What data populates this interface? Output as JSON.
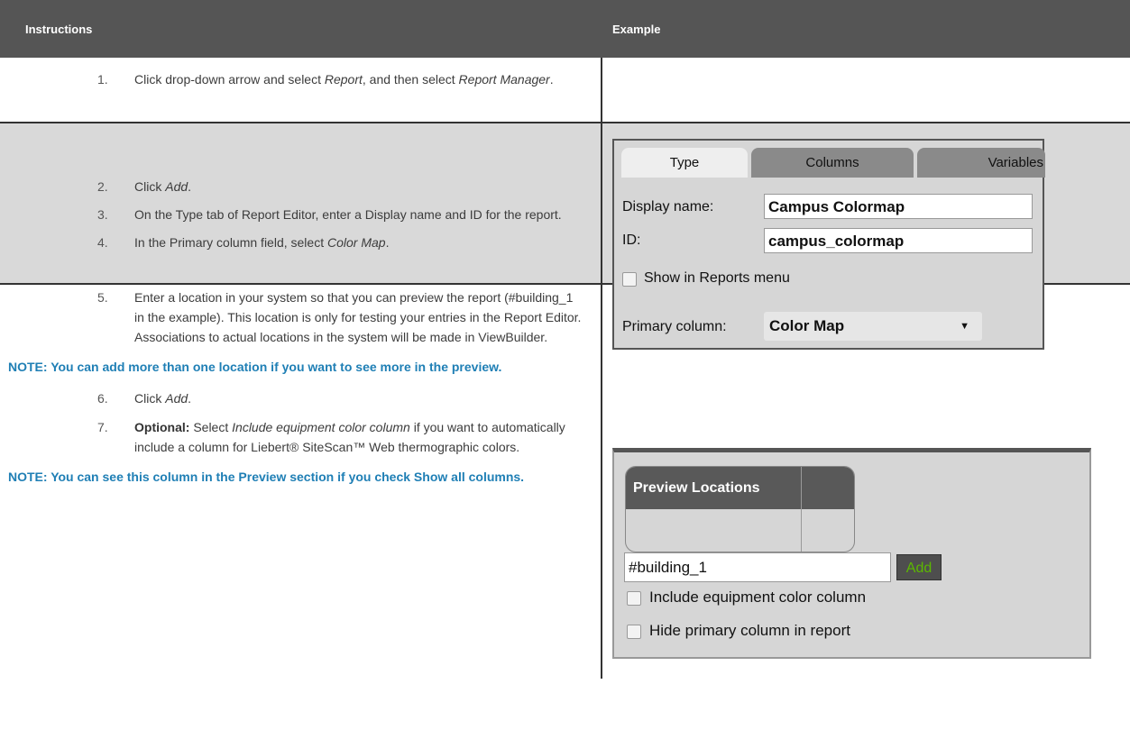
{
  "header": {
    "instructions": "Instructions",
    "example": "Example"
  },
  "steps": {
    "s1": {
      "num": "1.",
      "a": "Click drop-down arrow and select ",
      "b": "Report",
      "c": ", and then select ",
      "d": "Report Manager",
      "e": "."
    },
    "s2": {
      "num": "2.",
      "a": "Click ",
      "b": "Add",
      "c": "."
    },
    "s3": {
      "num": "3.",
      "text": "On the Type tab of Report Editor, enter a Display name and ID for the report."
    },
    "s4": {
      "num": "4.",
      "a": "In the Primary column field, select ",
      "b": "Color Map",
      "c": "."
    },
    "s5": {
      "num": "5.",
      "text": "Enter a location in your system so that you can preview the report (#building_1 in the example). This location is only for testing your entries in the Report Editor. Associations to actual locations in the system will be made in ViewBuilder."
    },
    "note1": "NOTE: You can add more than one location if you want to see more in the preview.",
    "s6": {
      "num": "6.",
      "a": "Click ",
      "b": "Add",
      "c": "."
    },
    "s7": {
      "num": "7.",
      "strong": "Optional:",
      "a": " Select ",
      "b": "Include equipment color column",
      "c": " if you want to automatically include a column for Liebert® SiteScan™ Web thermographic colors."
    },
    "note2": "NOTE: You can see this column in the Preview section if you check Show all columns."
  },
  "type_example": {
    "tabs": [
      "Type",
      "Columns",
      "Variables"
    ],
    "display_name_label": "Display name:",
    "display_name_value": "Campus Colormap",
    "id_label": "ID:",
    "id_value": "campus_colormap",
    "show_in_reports_label": "Show in Reports menu",
    "primary_column_label": "Primary column:",
    "primary_column_value": "Color Map"
  },
  "preview_example": {
    "panel_title": "Preview Locations",
    "location_value": "#building_1",
    "add_label": "Add",
    "include_equipment_label": "Include equipment color column",
    "hide_primary_label": "Hide primary column in report"
  }
}
